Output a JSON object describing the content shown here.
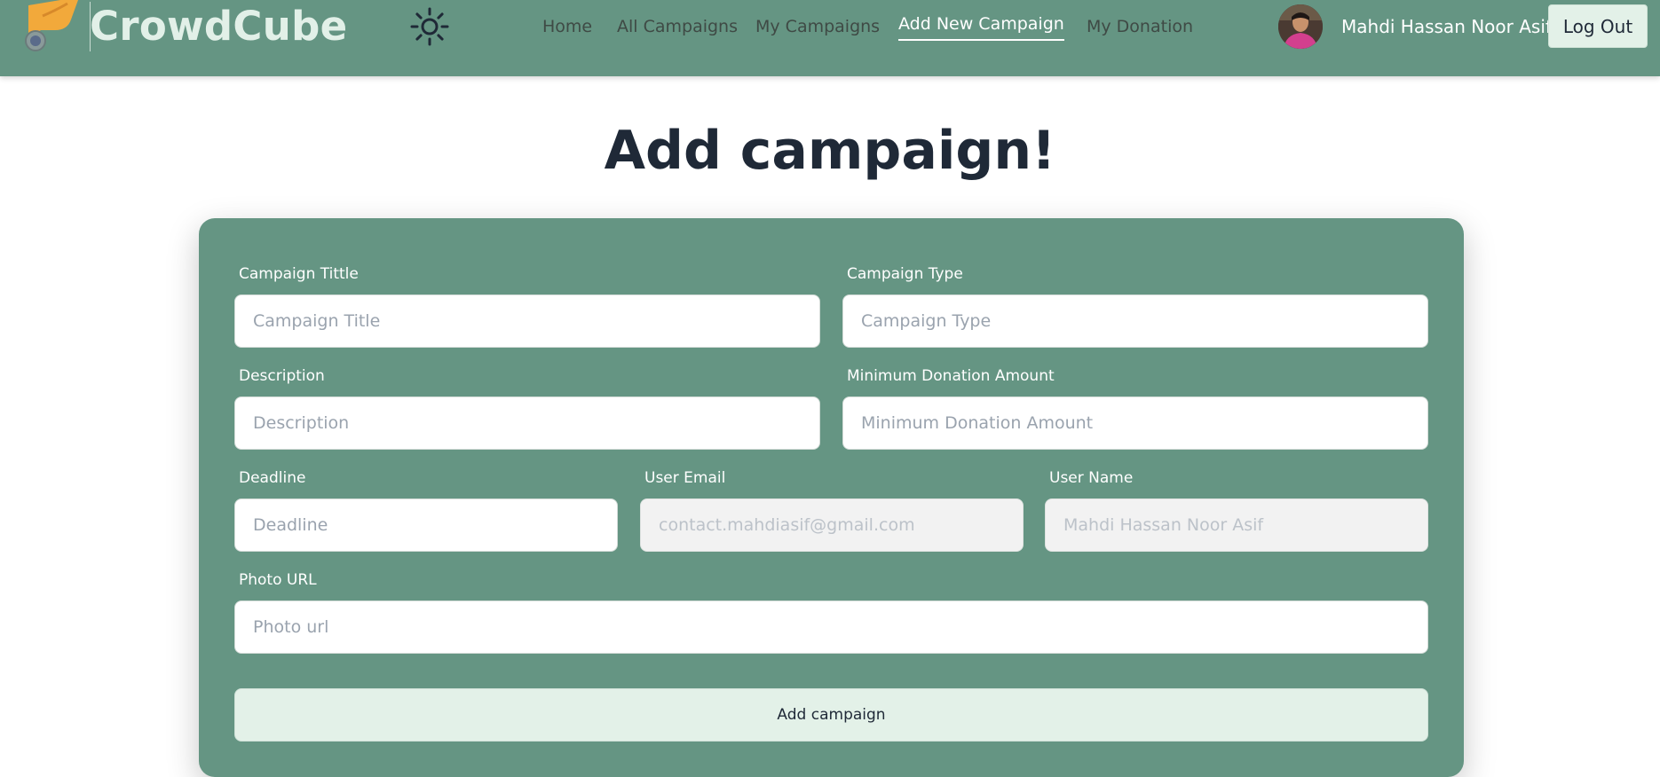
{
  "brand": {
    "name": "CrowdCube",
    "logo_icon": "hand-coin-icon",
    "logo_color": "#f2a93b"
  },
  "theme": {
    "icon": "sun-icon"
  },
  "nav": {
    "links": [
      {
        "label": "Home",
        "active": false
      },
      {
        "label": "All Campaigns",
        "active": false
      },
      {
        "label": "My Campaigns",
        "active": false
      },
      {
        "label": "Add New Campaign",
        "active": true
      },
      {
        "label": "My Donation",
        "active": false
      }
    ]
  },
  "user": {
    "name": "Mahdi Hassan Noor Asif",
    "avatar_icon": "user-avatar"
  },
  "logout_label": "Log Out",
  "page": {
    "title": "Add campaign!"
  },
  "form": {
    "title_field": {
      "label": "Campaign Tittle",
      "placeholder": "Campaign Title"
    },
    "type_field": {
      "label": "Campaign Type",
      "placeholder": "Campaign Type"
    },
    "description_field": {
      "label": "Description",
      "placeholder": "Description"
    },
    "min_donation_field": {
      "label": "Minimum Donation Amount",
      "placeholder": "Minimum Donation Amount"
    },
    "deadline_field": {
      "label": "Deadline",
      "placeholder": "Deadline"
    },
    "email_field": {
      "label": "User Email",
      "placeholder": "contact.mahdiasif@gmail.com"
    },
    "username_field": {
      "label": "User Name",
      "placeholder": "Mahdi Hassan Noor Asif"
    },
    "photo_field": {
      "label": "Photo URL",
      "placeholder": "Photo url"
    },
    "submit_label": "Add campaign"
  },
  "colors": {
    "primary": "#659583",
    "accent_light": "#e3f1e8",
    "text_dark": "#1f2937"
  }
}
